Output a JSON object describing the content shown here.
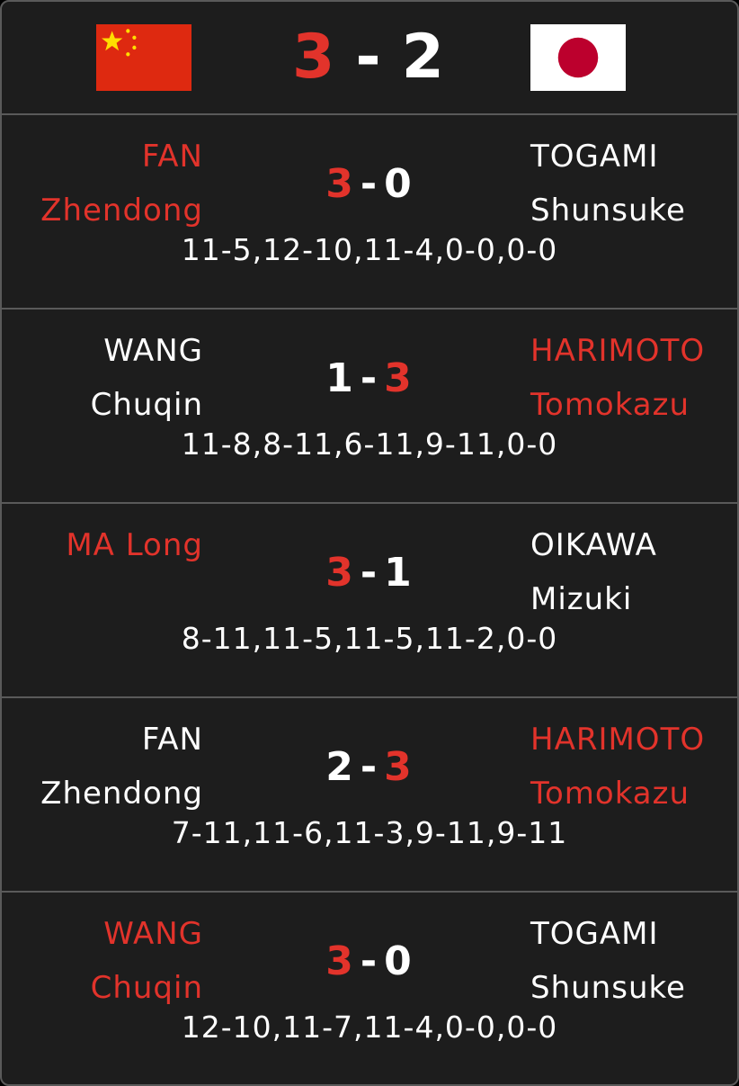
{
  "colors": {
    "background": "#1d1d1d",
    "border": "#5a5a5a",
    "winner": "#e2332b",
    "text": "#ffffff",
    "china_flag_red": "#de2910",
    "china_flag_star": "#ffde00",
    "japan_flag_white": "#ffffff",
    "japan_flag_disc": "#bc002d"
  },
  "header": {
    "left_flag": "china-flag",
    "right_flag": "japan-flag",
    "home_score": "3",
    "separator": "-",
    "away_score": "2"
  },
  "matches": [
    {
      "left_first": "FAN",
      "left_last": "Zhendong",
      "right_first": "TOGAMI",
      "right_last": "Shunsuke",
      "left_score": "3",
      "separator": "-",
      "right_score": "0",
      "winner": "left",
      "games": "11-5,12-10,11-4,0-0,0-0"
    },
    {
      "left_first": "WANG",
      "left_last": "Chuqin",
      "right_first": "HARIMOTO",
      "right_last": "Tomokazu",
      "left_score": "1",
      "separator": "-",
      "right_score": "3",
      "winner": "right",
      "games": "11-8,8-11,6-11,9-11,0-0"
    },
    {
      "left_first": "MA Long",
      "left_last": "",
      "right_first": "OIKAWA",
      "right_last": "Mizuki",
      "left_score": "3",
      "separator": "-",
      "right_score": "1",
      "winner": "left",
      "games": "8-11,11-5,11-5,11-2,0-0"
    },
    {
      "left_first": "FAN",
      "left_last": "Zhendong",
      "right_first": "HARIMOTO",
      "right_last": "Tomokazu",
      "left_score": "2",
      "separator": "-",
      "right_score": "3",
      "winner": "right",
      "games": "7-11,11-6,11-3,9-11,9-11"
    },
    {
      "left_first": "WANG",
      "left_last": "Chuqin",
      "right_first": "TOGAMI",
      "right_last": "Shunsuke",
      "left_score": "3",
      "separator": "-",
      "right_score": "0",
      "winner": "left",
      "games": "12-10,11-7,11-4,0-0,0-0"
    }
  ]
}
